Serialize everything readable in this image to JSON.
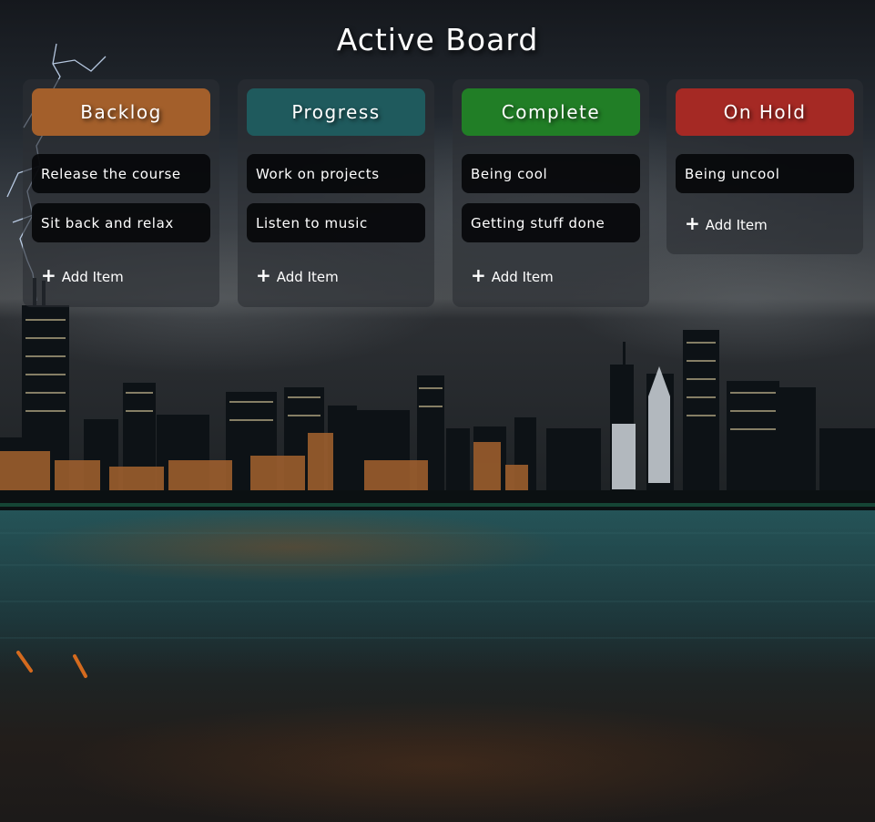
{
  "board": {
    "title": "Active Board"
  },
  "columns": [
    {
      "title": "Backlog",
      "color": "#a35f2b",
      "items": [
        "Release the course",
        "Sit back and relax"
      ],
      "add_label": "Add Item"
    },
    {
      "title": "Progress",
      "color": "#1f5a5d",
      "items": [
        "Work on projects",
        "Listen to music"
      ],
      "add_label": "Add Item"
    },
    {
      "title": "Complete",
      "color": "#217e26",
      "items": [
        "Being cool",
        "Getting stuff done"
      ],
      "add_label": "Add Item"
    },
    {
      "title": "On Hold",
      "color": "#a52924",
      "items": [
        "Being uncool"
      ],
      "add_label": "Add Item"
    }
  ],
  "icons": {
    "add": "plus-icon"
  }
}
